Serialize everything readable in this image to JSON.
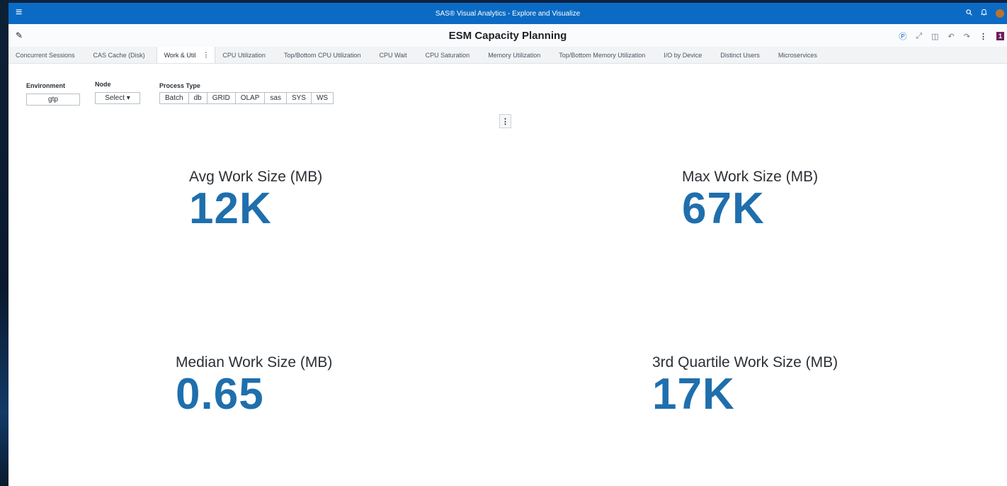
{
  "app": {
    "title": "SAS® Visual Analytics - Explore and Visualize",
    "menu_icon": "hamburger-icon",
    "right_icons": [
      "search-icon",
      "bell-icon",
      "avatar"
    ]
  },
  "report": {
    "title": "ESM Capacity Planning",
    "toolbar_icons": [
      "help-icon",
      "expand-icon",
      "layout-icon",
      "undo-icon",
      "redo-icon",
      "more-icon"
    ],
    "badge": "1"
  },
  "tabs": [
    {
      "label": "Concurrent Sessions"
    },
    {
      "label": "CAS Cache (Disk)"
    },
    {
      "label": "Work & Util",
      "active": true
    },
    {
      "label": "CPU Utilization"
    },
    {
      "label": "Top/Bottom CPU Utilization"
    },
    {
      "label": "CPU Wait"
    },
    {
      "label": "CPU Saturation"
    },
    {
      "label": "Memory Utilization"
    },
    {
      "label": "Top/Bottom Memory Utilization"
    },
    {
      "label": "I/O by Device"
    },
    {
      "label": "Distinct Users"
    },
    {
      "label": "Microservices"
    }
  ],
  "controls": {
    "environment": {
      "label": "Environment",
      "value": "gtp"
    },
    "node": {
      "label": "Node",
      "value": "Select ▾"
    },
    "process_type": {
      "label": "Process Type",
      "options": [
        "Batch",
        "db",
        "GRID",
        "OLAP",
        "sas",
        "SYS",
        "WS"
      ]
    }
  },
  "kpis": [
    {
      "label": "Avg Work Size (MB)",
      "value": "12K"
    },
    {
      "label": "Max Work Size (MB)",
      "value": "67K"
    },
    {
      "label": "Median Work Size (MB)",
      "value": "0.65"
    },
    {
      "label": "3rd Quartile Work Size (MB)",
      "value": "17K"
    }
  ],
  "colors": {
    "appbar": "#0b6bc4",
    "kpi_value": "#1f6fad",
    "badge": "#6b1f5c"
  }
}
